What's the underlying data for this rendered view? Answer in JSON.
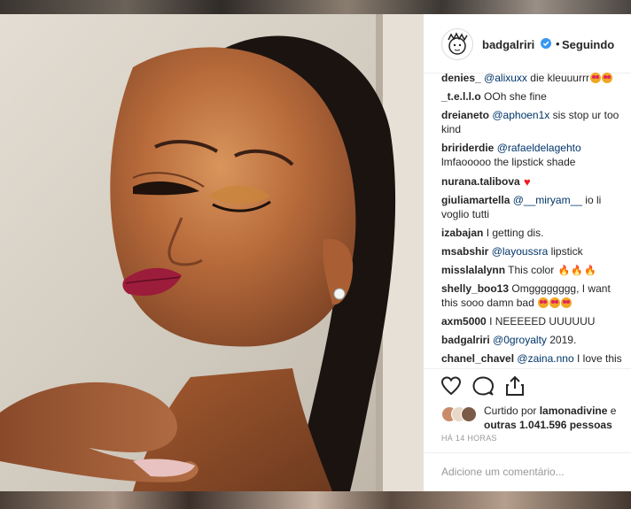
{
  "post": {
    "username": "badgalriri",
    "separator": "•",
    "follow_label": "Seguindo"
  },
  "comments": [
    {
      "user": "denies_",
      "mention": "@alixuxx",
      "text": "die kleuuurrr",
      "emoji": [
        "eyes",
        "eyes"
      ]
    },
    {
      "user": "_t.e.l.l.o",
      "mention": "",
      "text": "OOh she fine",
      "emoji": []
    },
    {
      "user": "dreianeto",
      "mention": "@aphoen1x",
      "text": "sis stop ur too kind",
      "emoji": []
    },
    {
      "user": "bririderdie",
      "mention": "@rafaeldelagehto",
      "text": "lmfaooooo the lipstick shade",
      "emoji": []
    },
    {
      "user": "nurana.talibova",
      "mention": "",
      "text": "",
      "emoji": [
        "heart"
      ]
    },
    {
      "user": "giuliamartella",
      "mention": "@__miryam__",
      "text": "io li voglio tutti",
      "emoji": []
    },
    {
      "user": "izabajan",
      "mention": "",
      "text": "I getting dis.",
      "emoji": []
    },
    {
      "user": "msabshir",
      "mention": "@layoussra",
      "text": "lipstick",
      "emoji": []
    },
    {
      "user": "misslalalynn",
      "mention": "",
      "text": "This color",
      "emoji": [
        "fire",
        "fire",
        "fire"
      ]
    },
    {
      "user": "shelly_boo13",
      "mention": "",
      "text": "Omgggggggg, I want this sooo damn bad",
      "emoji": [
        "eyes",
        "eyes",
        "eyes"
      ]
    },
    {
      "user": "axm5000",
      "mention": "",
      "text": "I NEEEEED UUUUUU",
      "emoji": []
    },
    {
      "user": "badgalriri",
      "mention": "@0groyalty",
      "text": "2019.",
      "emoji": []
    },
    {
      "user": "chanel_chavel",
      "mention": "@zaina.nno",
      "text": "I love this",
      "emoji": []
    }
  ],
  "likes": {
    "prefix": "Curtido por",
    "user": "lamonadivine",
    "joiner": "e",
    "others": "outras 1.041.596 pessoas"
  },
  "timestamp": "HÁ 14 HORAS",
  "add_comment_placeholder": "Adicione um comentário...",
  "icons": {
    "like": "heart-outline-icon",
    "comment": "speech-bubble-icon",
    "share": "share-icon",
    "verified": "verified-badge-icon"
  },
  "colors": {
    "lip": "#9c1c3b",
    "verified": "#3897f0",
    "mention": "#003569"
  }
}
